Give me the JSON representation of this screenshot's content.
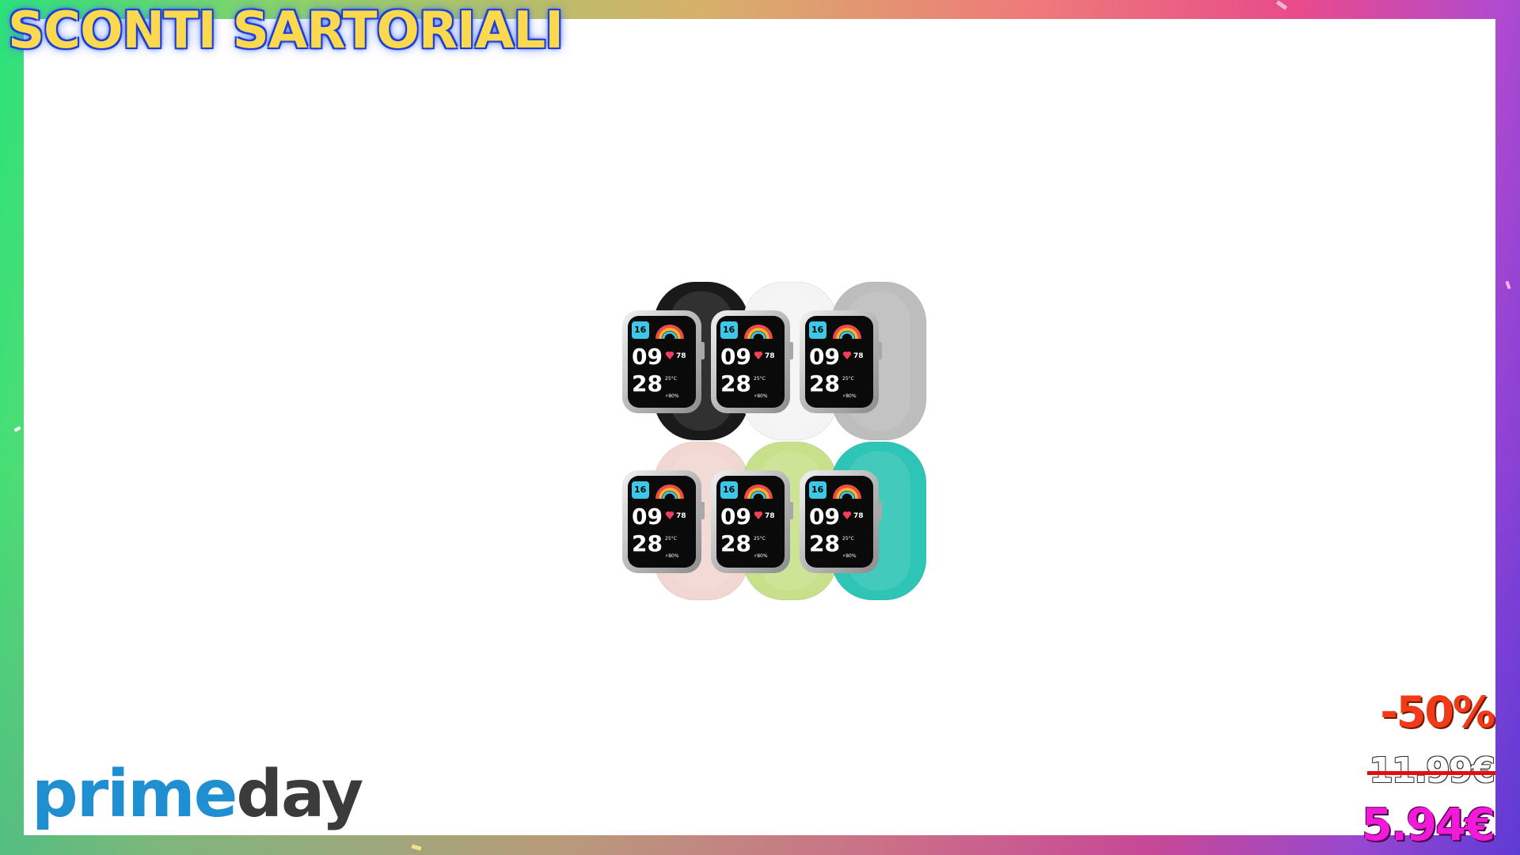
{
  "banner": {
    "headline": "SCONTI SARTORIALI",
    "logo": {
      "part1": "prime",
      "part2": "day"
    }
  },
  "product": {
    "image_alt": "product-photo-smartwatch-straps",
    "watch_display": {
      "date": "16",
      "hour": "09",
      "minute": "28",
      "heart_rate": "78",
      "temp": "25°C",
      "battery": "80%"
    },
    "strap_colors": [
      "#1a1a1a",
      "#f4f4f4",
      "#bdbdbd",
      "#f1d6d2",
      "#c8e08a",
      "#2ec4b6"
    ]
  },
  "pricing": {
    "discount": "-50%",
    "old_price": "11.99€",
    "new_price": "5.94€"
  },
  "colors": {
    "headline_text": "#fbd94e",
    "headline_outline": "#1d3fd8",
    "discount": "#f03a1a",
    "new_price": "#f01ad8",
    "logo_blue": "#1f8fd1",
    "logo_dark": "#3b3b3b"
  }
}
